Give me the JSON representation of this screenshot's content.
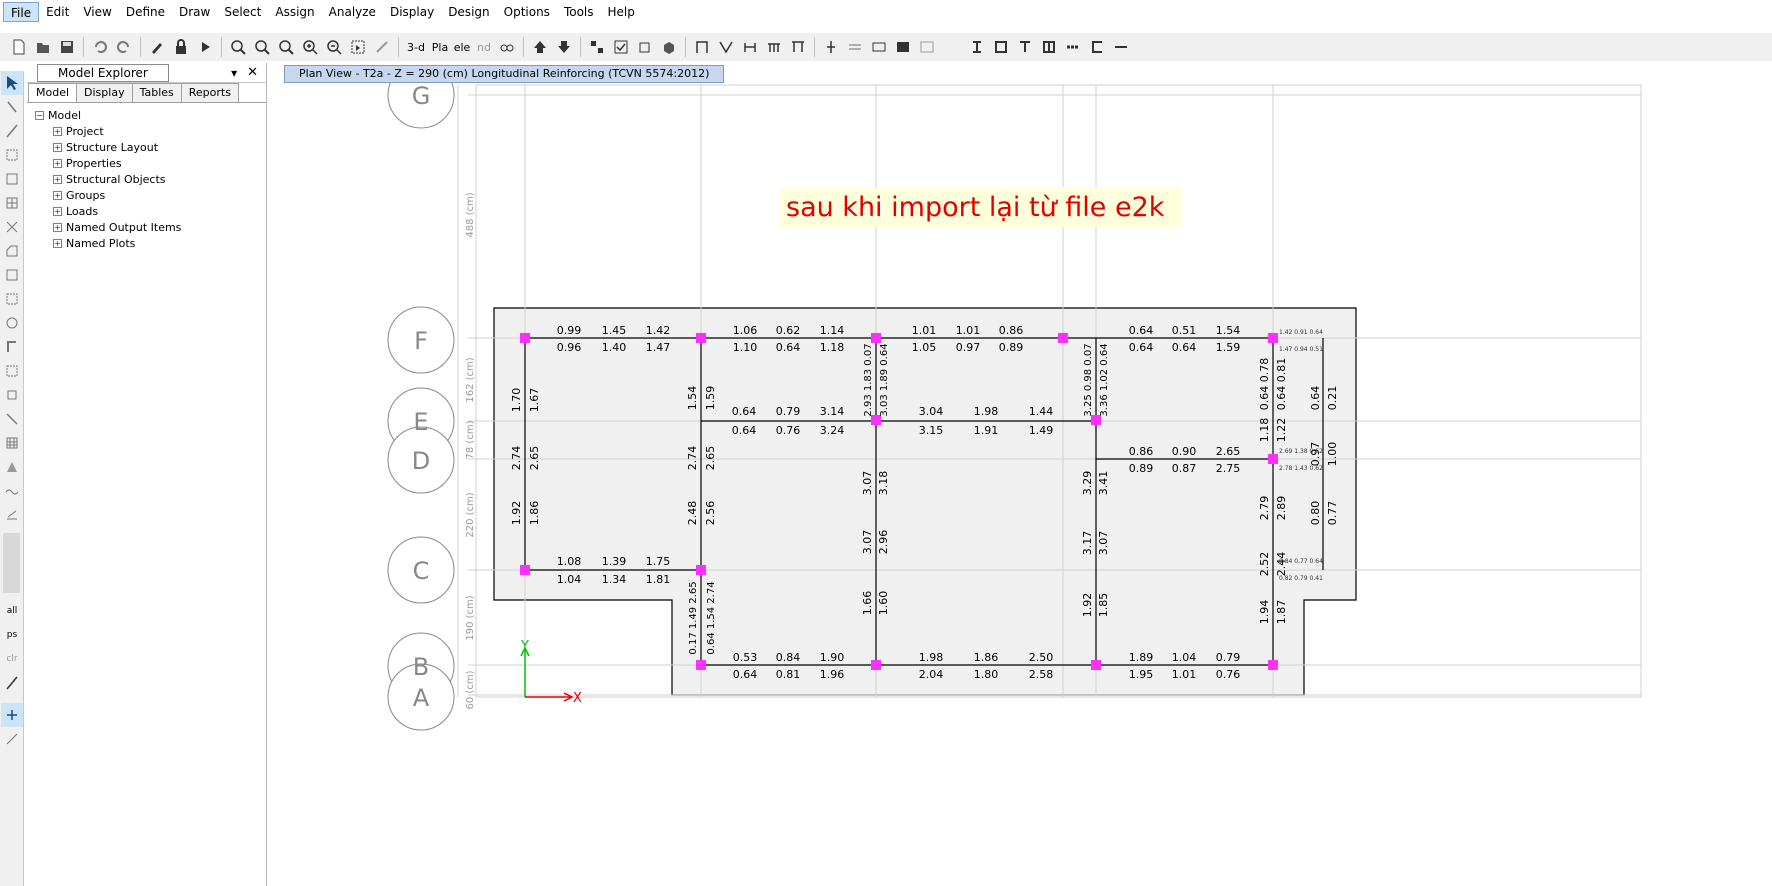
{
  "menu": [
    "File",
    "Edit",
    "View",
    "Define",
    "Draw",
    "Select",
    "Assign",
    "Analyze",
    "Display",
    "Design",
    "Options",
    "Tools",
    "Help"
  ],
  "toolbar": {
    "labels": [
      "3-d",
      "Pla",
      "ele",
      "nd"
    ],
    "icons": [
      "new-file-icon",
      "open-icon",
      "save-icon",
      "undo-icon",
      "redo-icon",
      "pencil-icon",
      "lock-icon",
      "run-icon",
      "zoom-window-icon",
      "zoom-restore-icon",
      "zoom-previous-icon",
      "zoom-in-icon",
      "zoom-out-icon",
      "pan-icon",
      "rubber-band-icon",
      "3d-view-icon",
      "plan-view-icon",
      "elevation-view-icon",
      "rotate-icon",
      "glasses-icon",
      "move-up-icon",
      "move-down-icon"
    ]
  },
  "explorer": {
    "title": "Model Explorer",
    "tabs": [
      "Model",
      "Display",
      "Tables",
      "Reports"
    ],
    "root": "Model",
    "items": [
      "Project",
      "Structure Layout",
      "Properties",
      "Structural Objects",
      "Groups",
      "Loads",
      "Named Output Items",
      "Named Plots"
    ]
  },
  "view": {
    "tab_title": "Plan View - T2a - Z = 290 (cm)  Longitudinal Reinforcing  (TCVN 5574:2012)",
    "annotation": "sau khi import lại từ file e2k",
    "grid_bubbles": [
      "G",
      "F",
      "E",
      "D",
      "C",
      "B",
      "A"
    ],
    "dimensions": [
      "488 (cm)",
      "162 (cm)",
      "78 (cm)",
      "220 (cm)",
      "190 (cm)",
      "60 (cm)"
    ],
    "axis_labels": [
      "Y",
      "X"
    ],
    "rebar_values_h": [
      "0.99",
      "1.45",
      "1.42",
      "0.96",
      "1.40",
      "1.47",
      "1.06",
      "0.62",
      "1.14",
      "1.10",
      "0.64",
      "1.18",
      "1.01",
      "1.01",
      "0.86",
      "1.05",
      "0.97",
      "0.89",
      "0.64",
      "0.51",
      "1.54",
      "0.64",
      "0.64",
      "1.59",
      "0.64",
      "0.79",
      "3.14",
      "0.64",
      "0.76",
      "3.24",
      "3.04",
      "1.98",
      "1.44",
      "3.15",
      "1.91",
      "1.49",
      "0.86",
      "0.90",
      "2.65",
      "0.89",
      "0.87",
      "2.75",
      "1.08",
      "1.39",
      "1.75",
      "1.04",
      "1.34",
      "1.81",
      "0.53",
      "0.84",
      "1.90",
      "0.64",
      "0.81",
      "1.96",
      "1.98",
      "1.86",
      "2.50",
      "2.04",
      "1.80",
      "2.58",
      "1.89",
      "1.04",
      "0.79",
      "1.95",
      "1.01",
      "0.76"
    ],
    "rebar_values_v": [
      "1.70",
      "1.67",
      "2.74",
      "2.65",
      "1.92",
      "1.86",
      "1.54",
      "1.59",
      "2.74",
      "2.65",
      "2.48",
      "2.56",
      "0.17 1.49 2.65",
      "0.64 1.54 2.74",
      "2.93 1.83 0.07",
      "3.03 1.89 0.64",
      "3.07",
      "3.18",
      "3.07",
      "2.96",
      "1.66",
      "1.60",
      "3.25 0.98 0.07",
      "3.36 1.02 0.64",
      "3.29",
      "3.41",
      "3.17",
      "3.07",
      "1.92",
      "1.85",
      "0.78",
      "0.81",
      "0.64",
      "0.64",
      "1.18",
      "1.22",
      "2.79",
      "2.89",
      "2.52",
      "2.44",
      "1.94",
      "1.87",
      "0.64",
      "0.21",
      "0.97",
      "1.00",
      "0.80",
      "0.77"
    ],
    "small_labels": [
      "1.42 0.91 0.64",
      "1.47 0.94 0.51",
      "2.69 1.38 0.62",
      "2.78 1.43 0.62",
      "0.84 0.77 0.64",
      "0.82 0.79 0.41"
    ]
  }
}
